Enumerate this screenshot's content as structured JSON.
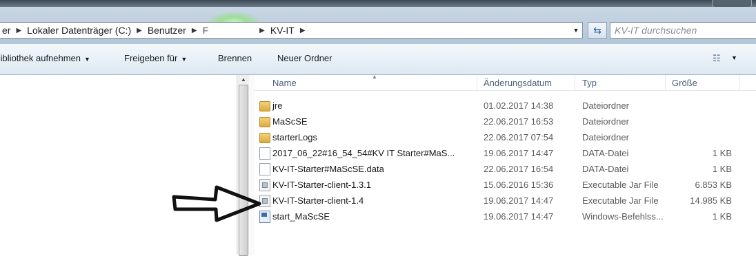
{
  "address_bar": {
    "crumbs": [
      "er",
      "Lokaler Datenträger (C:)",
      "Benutzer",
      "F",
      "KV-IT"
    ],
    "search_placeholder": "KV-IT durchsuchen"
  },
  "toolbar": {
    "library": "Bibliothek aufnehmen",
    "share": "Freigeben für",
    "burn": "Brennen",
    "new_folder": "Neuer Ordner"
  },
  "columns": {
    "name": "Name",
    "date": "Änderungsdatum",
    "type": "Typ",
    "size": "Größe"
  },
  "files": [
    {
      "icon": "folder-icon",
      "name": "jre",
      "date": "01.02.2017 14:38",
      "type": "Dateiordner",
      "size": ""
    },
    {
      "icon": "folder-icon",
      "name": "MaScSE",
      "date": "22.06.2017 16:53",
      "type": "Dateiordner",
      "size": ""
    },
    {
      "icon": "folder-icon",
      "name": "starterLogs",
      "date": "22.06.2017 07:54",
      "type": "Dateiordner",
      "size": ""
    },
    {
      "icon": "file-icon",
      "name": "2017_06_22#16_54_54#KV IT Starter#MaS...",
      "date": "19.06.2017 14:47",
      "type": "DATA-Datei",
      "size": "1 KB"
    },
    {
      "icon": "file-icon",
      "name": "KV-IT-Starter#MaScSE.data",
      "date": "22.06.2017 16:54",
      "type": "DATA-Datei",
      "size": "1 KB"
    },
    {
      "icon": "jar-icon",
      "name": "KV-IT-Starter-client-1.3.1",
      "date": "15.06.2016 15:36",
      "type": "Executable Jar File",
      "size": "6.853 KB"
    },
    {
      "icon": "jar-icon",
      "name": "KV-IT-Starter-client-1.4",
      "date": "19.06.2017 14:47",
      "type": "Executable Jar File",
      "size": "14.985 KB"
    },
    {
      "icon": "cmd-icon",
      "name": "start_MaScSE",
      "date": "19.06.2017 14:47",
      "type": "Windows-Befehlss...",
      "size": "1 KB"
    }
  ],
  "colors": {
    "address_bg": "#c2d2e2",
    "toolbar_bg": "#e6eef7",
    "header_text": "#4c607a"
  }
}
